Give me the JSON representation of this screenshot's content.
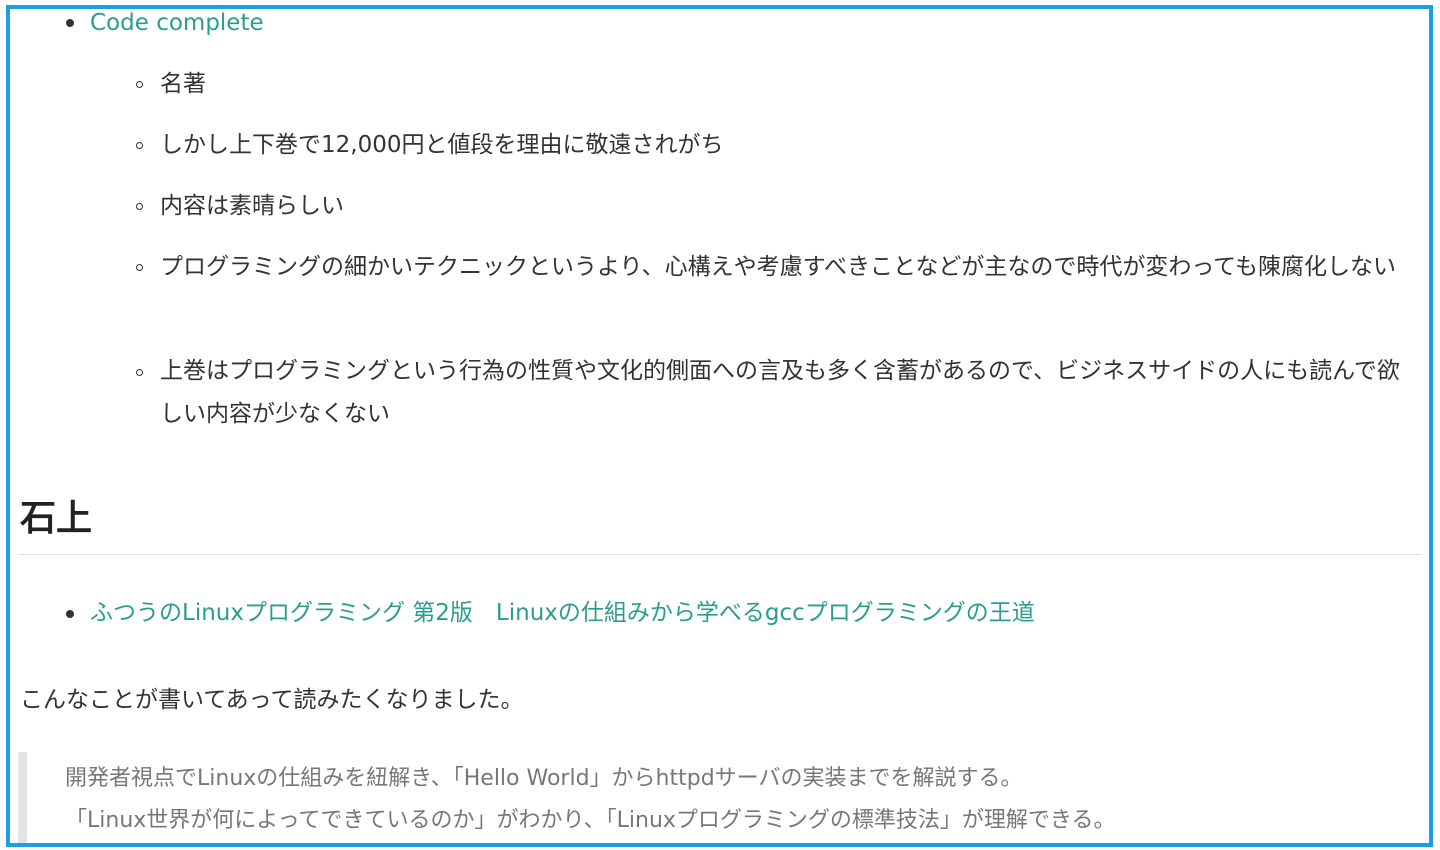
{
  "section_top": {
    "book_link": "Code complete",
    "notes": [
      "名著",
      "しかし上下巻で12,000円と値段を理由に敬遠されがち",
      "内容は素晴らしい",
      "プログラミングの細かいテクニックというより、心構えや考慮すべきことなどが主なので時代が変わっても陳腐化しない",
      "上巻はプログラミングという行為の性質や文化的側面への言及も多く含蓄があるので、ビジネスサイドの人にも読んで欲しい内容が少なくない"
    ]
  },
  "section_ishigami": {
    "heading": "石上",
    "book_link": "ふつうのLinuxプログラミング 第2版　Linuxの仕組みから学べるgccプログラミングの王道",
    "paragraph": "こんなことが書いてあって読みたくなりました。",
    "quote_lines": [
      "開発者視点でLinuxの仕組みを紐解き、「Hello World」からhttpdサーバの実装までを解説する。",
      "「Linux世界が何によってできているのか」がわかり、「Linuxプログラミングの標準技法」が理解できる。"
    ]
  },
  "colors": {
    "frame_border": "#1a9fe0",
    "link": "#2a9d8f",
    "text": "#333333",
    "quote_text": "#777777",
    "quote_bar": "#e3e3e3"
  }
}
